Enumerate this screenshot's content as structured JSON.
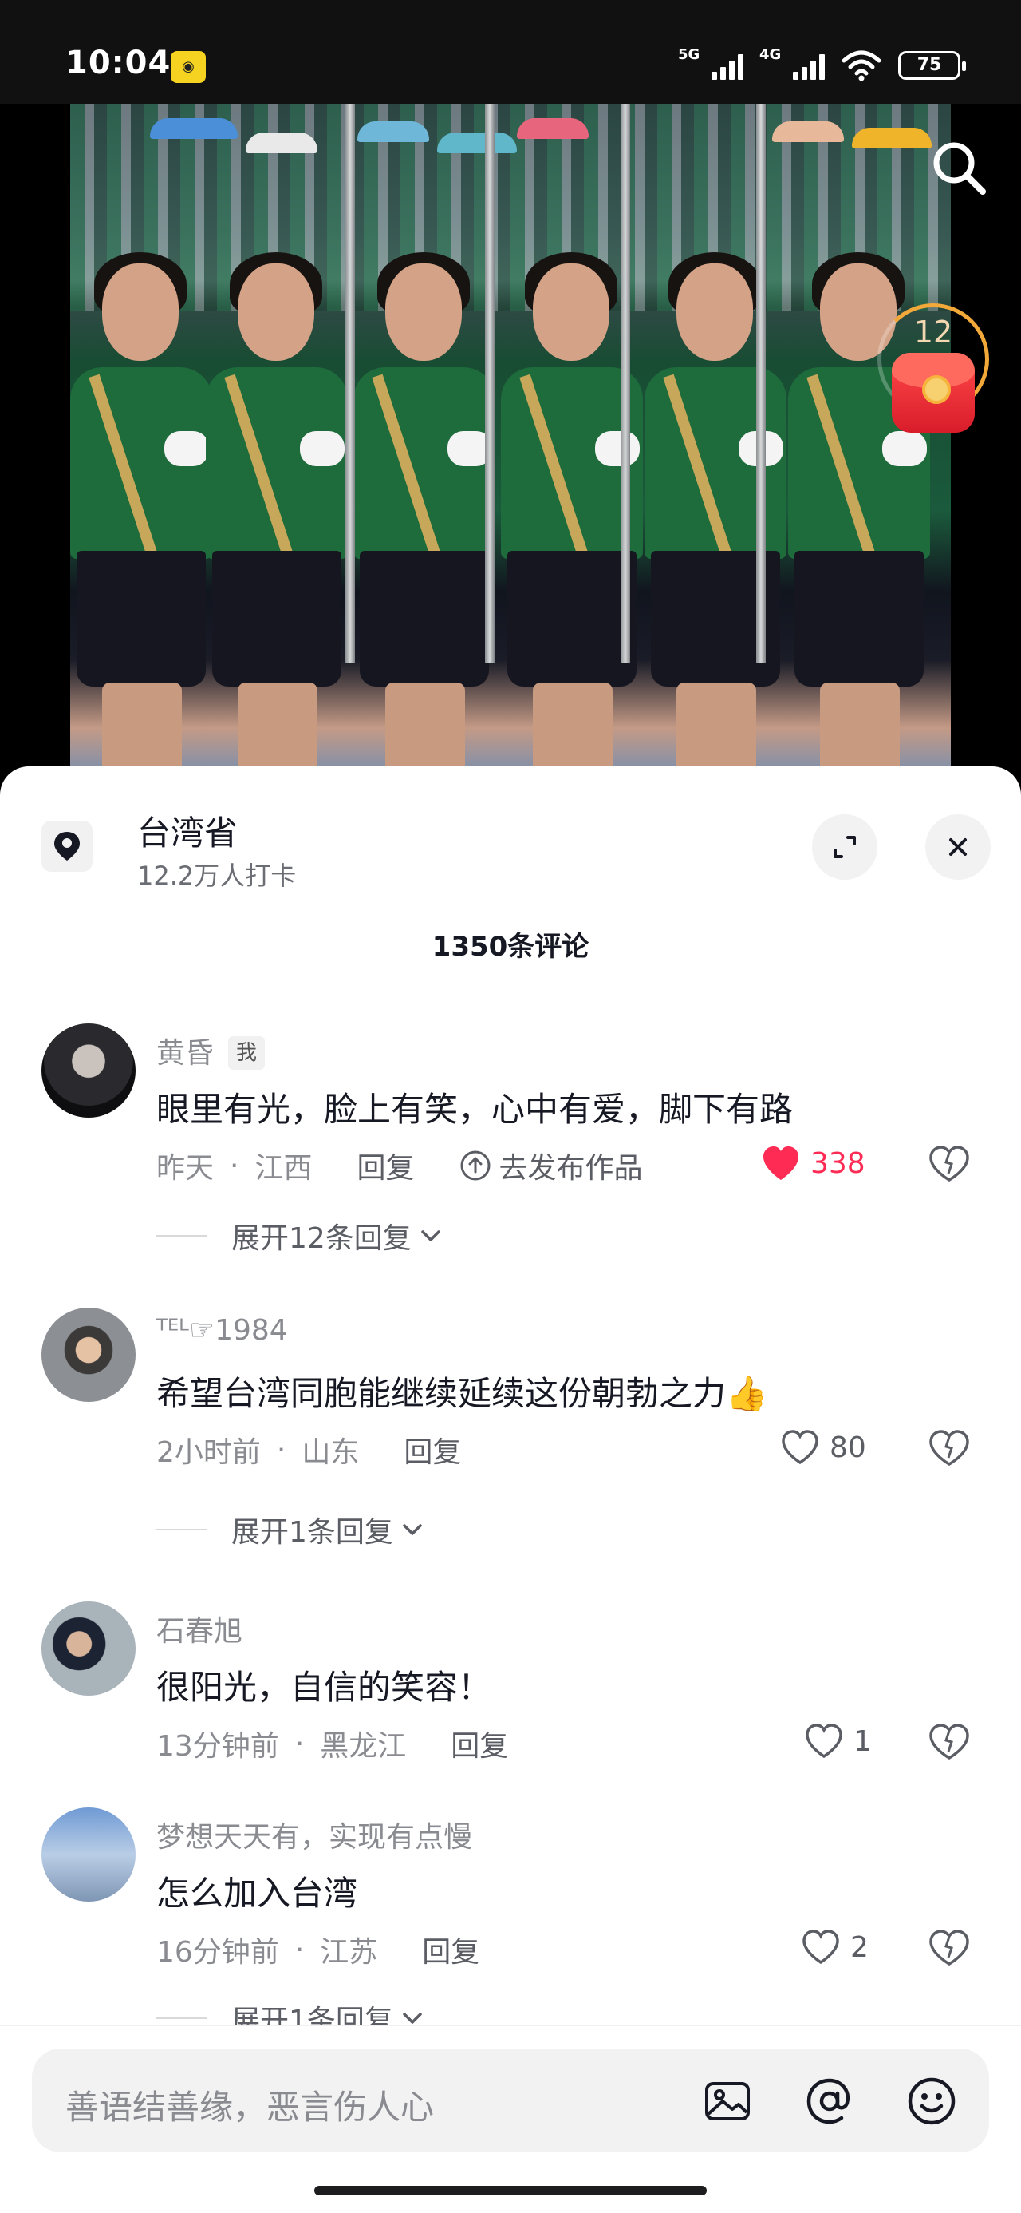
{
  "status_bar": {
    "time": "10:04",
    "signal1_label": "5G",
    "signal2_label": "4G",
    "battery": "75"
  },
  "video": {
    "red_packet_count": "12"
  },
  "location": {
    "title": "台湾省",
    "subtitle": "12.2万人打卡"
  },
  "comments_header": "1350条评论",
  "comments": [
    {
      "name": "黄昏",
      "tag": "我",
      "text": "眼里有光，脸上有笑，心中有爱，脚下有路",
      "time": "昨天",
      "region": "江西",
      "reply": "回复",
      "publish": "去发布作品",
      "likes": "338",
      "liked": true,
      "expand": "展开12条回复"
    },
    {
      "name": "ᵀᴱᴸ☞1984",
      "text": "希望台湾同胞能继续延续这份朝勃之力",
      "emoji": "👍",
      "time": "2小时前",
      "region": "山东",
      "reply": "回复",
      "likes": "80",
      "expand": "展开1条回复"
    },
    {
      "name": "石春旭",
      "text": "很阳光，自信的笑容！",
      "time": "13分钟前",
      "region": "黑龙江",
      "reply": "回复",
      "likes": "1"
    },
    {
      "name": "梦想天天有，实现有点慢",
      "text": "怎么加入台湾",
      "time": "16分钟前",
      "region": "江苏",
      "reply": "回复",
      "likes": "2",
      "expand": "展开1条回复"
    }
  ],
  "input": {
    "placeholder": "善语结善缘，恶言伤人心"
  },
  "icons": {
    "search": "search-icon",
    "location": "location-pin-icon",
    "expand": "expand-icon",
    "close": "close-icon",
    "heart": "heart-icon",
    "dislike": "dislike-heart-icon",
    "image": "image-icon",
    "at": "at-icon",
    "emoji": "emoji-icon"
  },
  "colors": {
    "liked": "#fe2c55",
    "muted": "#8a8b91",
    "text": "#161823"
  }
}
